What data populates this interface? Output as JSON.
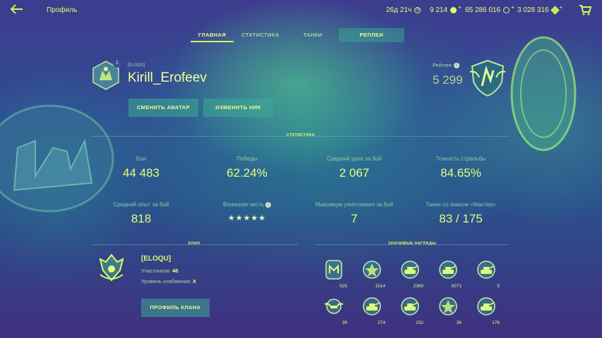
{
  "header": {
    "title": "Профиль",
    "currencies": [
      {
        "value": "26д 21ч",
        "icon": "premium-time-icon"
      },
      {
        "value": "9 214",
        "icon": "gold-icon"
      },
      {
        "value": "65 286 016",
        "icon": "credits-icon"
      },
      {
        "value": "3 028 316",
        "icon": "free-xp-icon"
      }
    ]
  },
  "tabs": [
    {
      "label": "ГЛАВНАЯ",
      "active": true
    },
    {
      "label": "СТАТИСТИКА",
      "active": false
    },
    {
      "label": "ТАНКИ",
      "active": false
    },
    {
      "label": "РЕПЛЕИ",
      "active": false
    }
  ],
  "player": {
    "clan_tag": "[ELOQU]",
    "badge_count": "1",
    "nickname": "Kirill_Erofeev",
    "change_avatar": "СМЕНИТЬ АВАТАР",
    "change_nick": "ИЗМЕНИТЬ НИК",
    "rating_label": "Рейтинг",
    "rating_value": "5 299"
  },
  "stats_section_title": "СТАТИСТИКА",
  "stats": [
    {
      "label": "Бои",
      "value": "44 483"
    },
    {
      "label": "Победы",
      "value": "62.24%"
    },
    {
      "label": "Средний урон за бой",
      "value": "2 067"
    },
    {
      "label": "Точность стрельбы",
      "value": "84.65%"
    },
    {
      "label": "Средний опыт за бой",
      "value": "818"
    },
    {
      "label": "Воинская честь",
      "value": "★★★★★"
    },
    {
      "label": "Максимум уничтожено за бой",
      "value": "7"
    },
    {
      "label": "Танки со знаком «Мастер»",
      "value": "83 / 175"
    }
  ],
  "clan": {
    "section_title": "КЛАН",
    "name": "[ELOQU]",
    "members_label": "Участников:",
    "members_value": "48",
    "supply_label": "Уровень снабжения:",
    "supply_value": "X",
    "profile_button": "ПРОФИЛЬ КЛАНА"
  },
  "awards": {
    "section_title": "ЗНАЧИМЫЕ НАГРАДЫ",
    "items": [
      {
        "count": "525",
        "icon": "master-badge-icon"
      },
      {
        "count": "1514",
        "icon": "medal-icon"
      },
      {
        "count": "2369",
        "icon": "tank-medal-icon"
      },
      {
        "count": "5071",
        "icon": "tank-medal-icon"
      },
      {
        "count": "5",
        "icon": "tank-medal-icon"
      },
      {
        "count": "39",
        "icon": "winged-medal-icon"
      },
      {
        "count": "274",
        "icon": "tank-medal-icon"
      },
      {
        "count": "152",
        "icon": "tank-medal-icon"
      },
      {
        "count": "36",
        "icon": "star-medal-icon"
      },
      {
        "count": "176",
        "icon": "tank-medal-icon"
      }
    ]
  }
}
